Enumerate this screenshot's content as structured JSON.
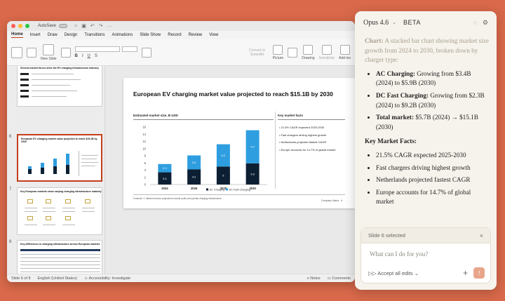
{
  "ppt": {
    "autosave": "AutoSave",
    "tabs": [
      "Home",
      "Insert",
      "Draw",
      "Design",
      "Transitions",
      "Animations",
      "Slide Show",
      "Record",
      "Review",
      "View"
    ],
    "ribbon": {
      "new_slide": "New Slide",
      "convert": "Convert to SmartArt",
      "picture": "Picture",
      "drawing": "Drawing",
      "sensitivity": "Sensitivity",
      "addins": "Add-ins"
    },
    "status": {
      "slide_of": "Slide 6 of 8",
      "language": "English (United States)",
      "accessibility": "Accessibility: Investigate",
      "notes": "Notes",
      "comments": "Comments"
    },
    "thumbnails": [
      {
        "num": "",
        "title": "Several market forces drive the EV charging infrastructure industry"
      },
      {
        "num": "6",
        "title": "European EV charging market value projected to reach $15.1B by 2030"
      },
      {
        "num": "7",
        "title": "Key European markets show varying charging infrastructure maturity"
      },
      {
        "num": "8",
        "title": "Key differences in charging infrastructure across European markets"
      }
    ]
  },
  "slide": {
    "title": "European EV charging market value projected to reach $15.1B by 2030",
    "chart_title": "Estimated market size, B USD",
    "facts_title": "Key market facts",
    "facts": [
      "21.5% CAGR expected 2025-2030",
      "Fast chargers driving highest growth",
      "Netherlands projected fastest CAGR",
      "Europe accounts for 14.7% of global market"
    ],
    "footnote": "Footnote: 1. Market revenue projections include public and private charging infrastructure",
    "company": "Company Name",
    "page_num": "6"
  },
  "chart_data": {
    "type": "bar",
    "stacked": true,
    "title": "Estimated market size, B USD",
    "categories": [
      "2024",
      "2026",
      "2028",
      "2030"
    ],
    "series": [
      {
        "name": "AC Charging",
        "values": [
          3.4,
          4.2,
          5.0,
          5.9
        ],
        "color": "#0d1f33"
      },
      {
        "name": "DC Fast Charging",
        "values": [
          2.3,
          3.9,
          6.2,
          9.2
        ],
        "color": "#2e9ee0"
      }
    ],
    "ylim": [
      0,
      16
    ],
    "yticks": [
      0,
      2,
      4,
      6,
      8,
      10,
      12,
      14,
      16
    ],
    "legend": "bottom"
  },
  "panel": {
    "model": "Opus 4.6",
    "badge": "BETA",
    "intro_label": "Chart:",
    "intro_text": "A stacked bar chart showing market size growth from 2024 to 2030, broken down by charger type:",
    "bullets": [
      {
        "label": "AC Charging:",
        "text": "Growing from $3.4B (2024) to $5.9B (2030)"
      },
      {
        "label": "DC Fast Charging:",
        "text": "Growing from $2.3B (2024) to $9.2B (2030)"
      },
      {
        "label": "Total market:",
        "text": "$5.7B (2024) → $15.1B (2030)"
      }
    ],
    "facts_heading": "Key Market Facts:",
    "facts": [
      "21.5% CAGR expected 2025-2030",
      "Fast chargers driving highest growth",
      "Netherlands projected fastest CAGR",
      "Europe accounts for 14.7% of global market"
    ],
    "selection": "Slide 6 selected",
    "placeholder": "What can I do for you?",
    "accept": "Accept all edits"
  },
  "colors": {
    "accent": "#c43e1c",
    "send": "#e8a58b",
    "background": "#d9694a"
  }
}
